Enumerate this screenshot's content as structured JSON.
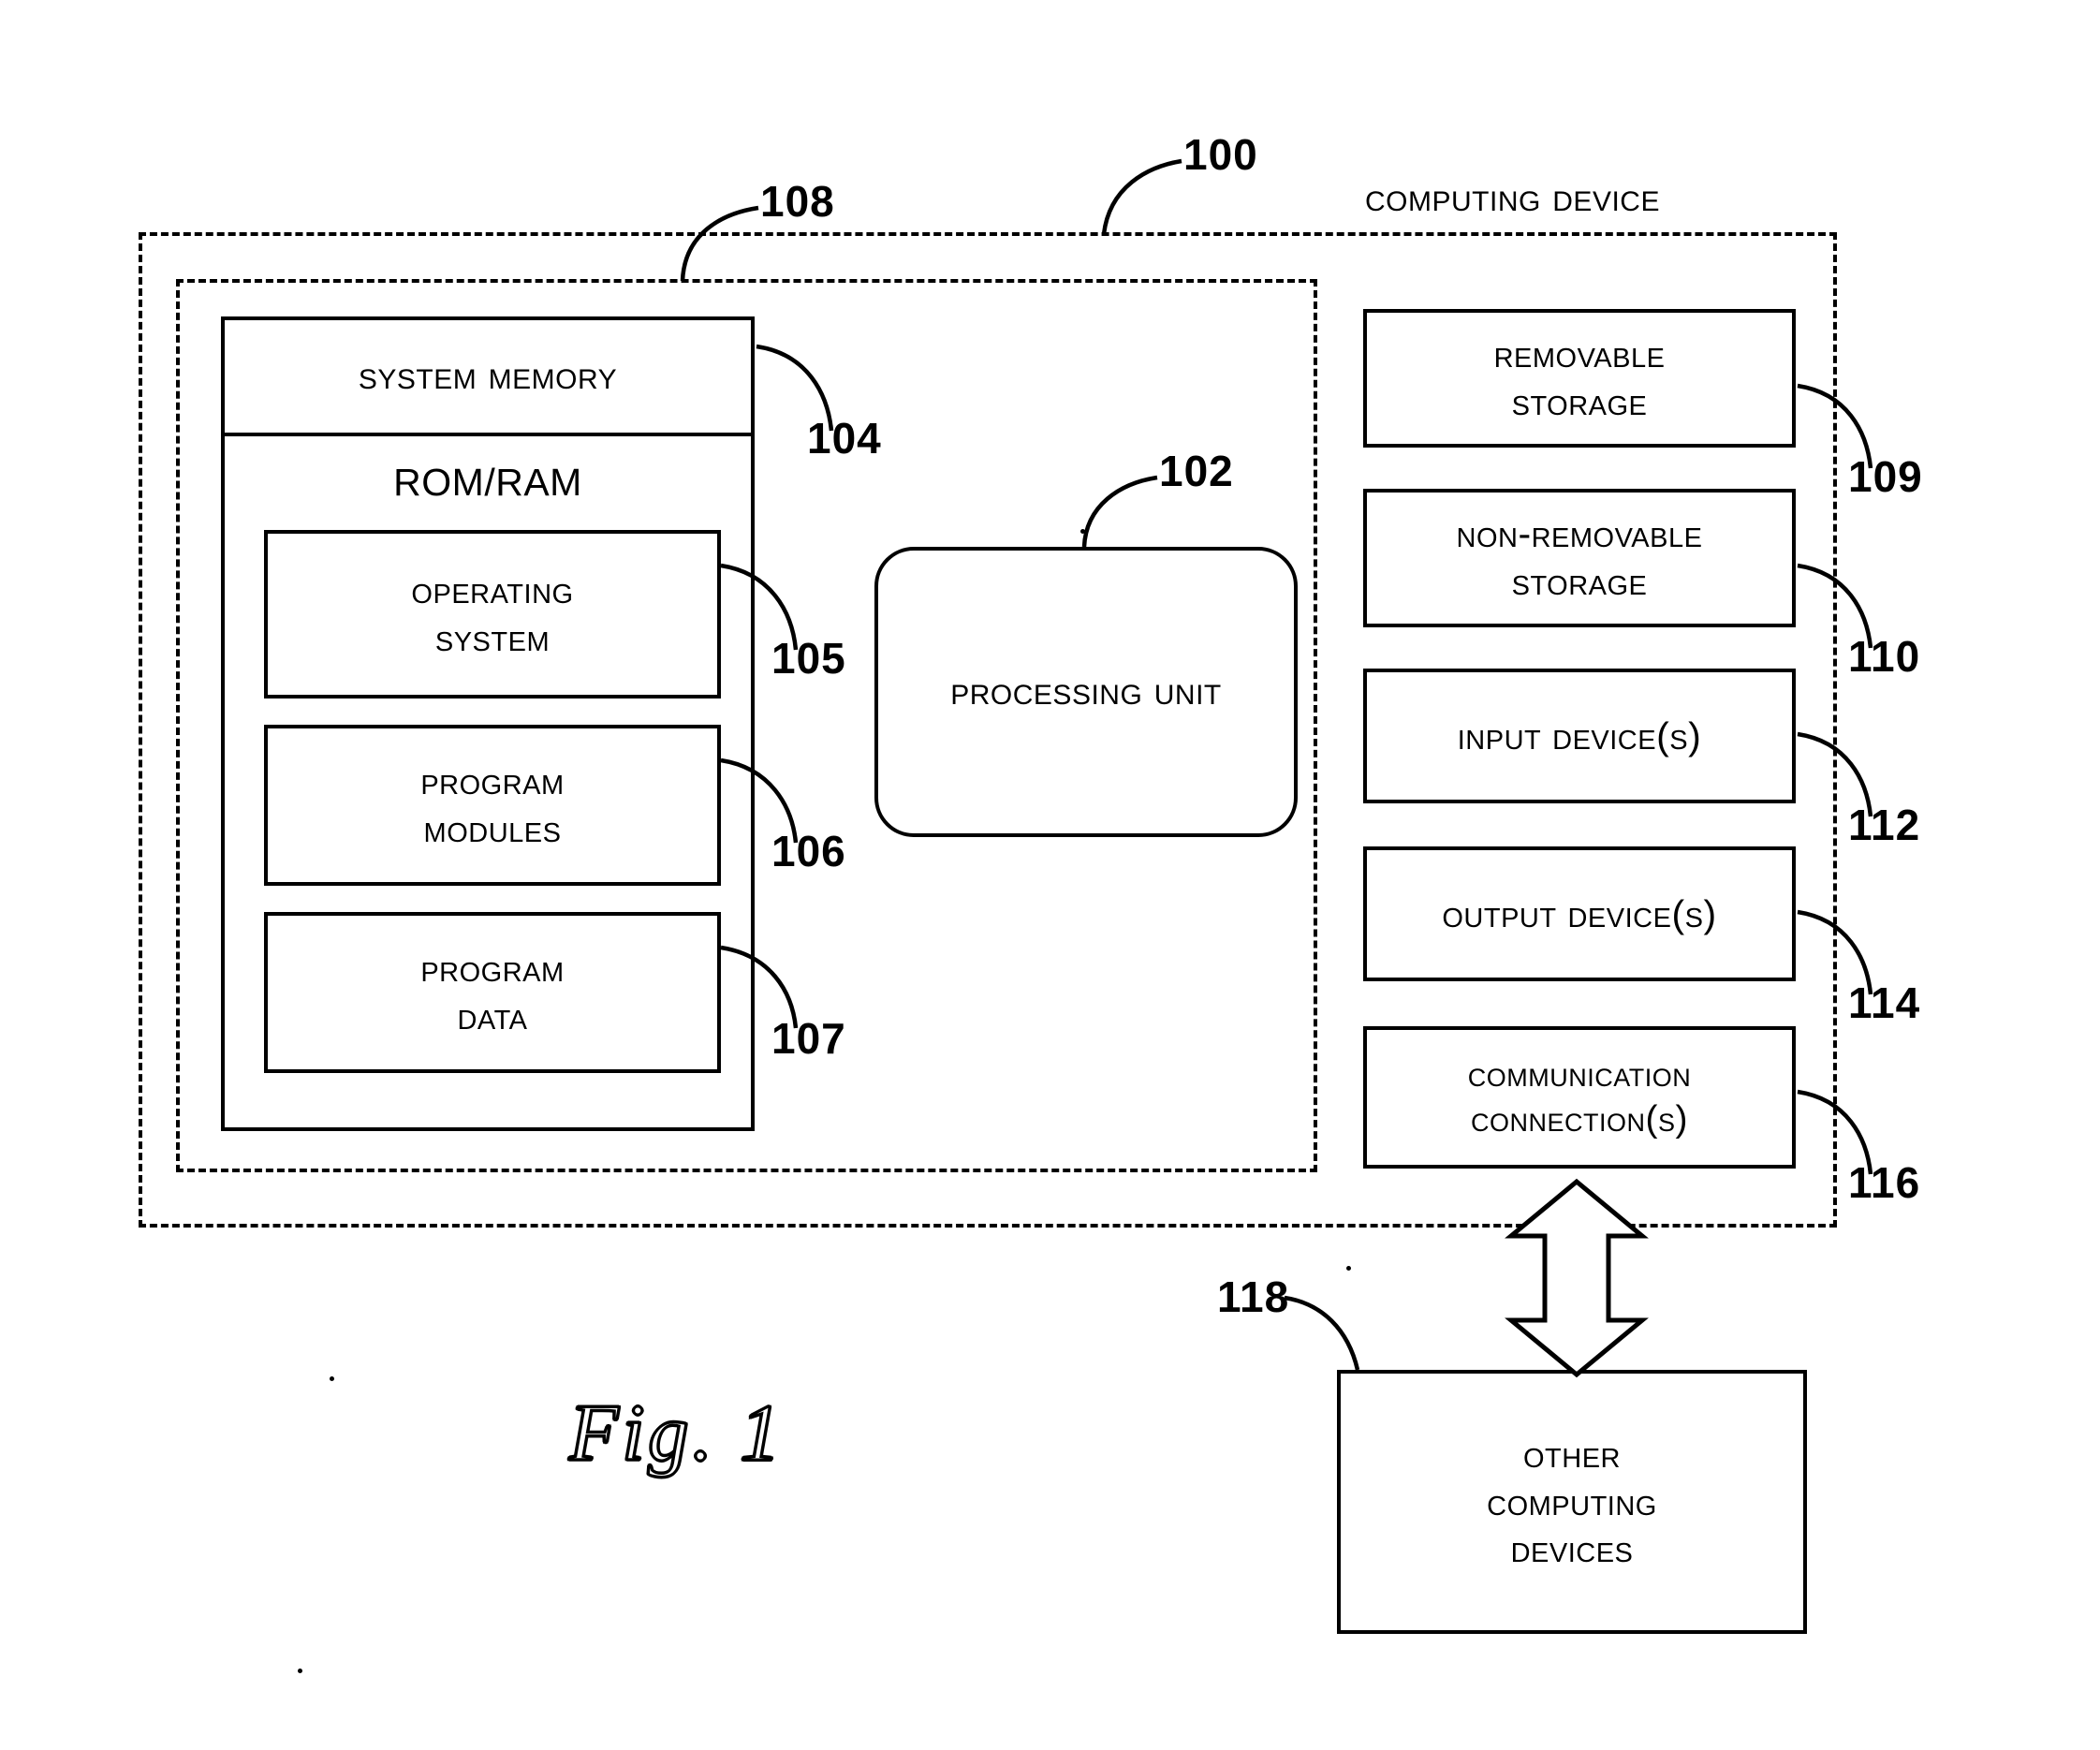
{
  "figure": {
    "caption": "Fig. 1",
    "title": "COMPUTING DEVICE"
  },
  "diagram": {
    "type": "block-diagram",
    "enclosures": [
      {
        "id": "computing-device",
        "label": "COMPUTING DEVICE",
        "ref": "100",
        "style": "dashed"
      },
      {
        "id": "basic-configuration",
        "label": "",
        "ref": "108",
        "style": "dashed"
      }
    ],
    "blocks": [
      {
        "id": "system-memory",
        "label": "SYSTEM MEMORY",
        "ref": "104",
        "shape": "rect"
      },
      {
        "id": "rom-ram",
        "label": "ROM/RAM",
        "ref": "",
        "shape": "rect"
      },
      {
        "id": "operating-system",
        "label": "OPERATING SYSTEM",
        "ref": "105",
        "shape": "rect",
        "lines": [
          "OPERATING",
          "SYSTEM"
        ]
      },
      {
        "id": "program-modules",
        "label": "PROGRAM MODULES",
        "ref": "106",
        "shape": "rect",
        "lines": [
          "PROGRAM",
          "MODULES"
        ]
      },
      {
        "id": "program-data",
        "label": "PROGRAM DATA",
        "ref": "107",
        "shape": "rect",
        "lines": [
          "PROGRAM",
          "DATA"
        ]
      },
      {
        "id": "processing-unit",
        "label": "PROCESSING UNIT",
        "ref": "102",
        "shape": "rounded-rect"
      },
      {
        "id": "removable-storage",
        "label": "REMOVABLE STORAGE",
        "ref": "109",
        "shape": "rect",
        "lines": [
          "REMOVABLE",
          "STORAGE"
        ]
      },
      {
        "id": "non-removable-storage",
        "label": "NON-REMOVABLE STORAGE",
        "ref": "110",
        "shape": "rect",
        "lines": [
          "NON-REMOVABLE",
          "STORAGE"
        ]
      },
      {
        "id": "input-devices",
        "label": "INPUT DEVICE(S)",
        "ref": "112",
        "shape": "rect"
      },
      {
        "id": "output-devices",
        "label": "OUTPUT DEVICE(S)",
        "ref": "114",
        "shape": "rect"
      },
      {
        "id": "communication-connections",
        "label": "COMMUNICATION CONNECTION(S)",
        "ref": "116",
        "shape": "rect",
        "lines": [
          "COMMUNICATION",
          "CONNECTION(S)"
        ]
      },
      {
        "id": "other-computing-devices",
        "label": "OTHER COMPUTING DEVICES",
        "ref": "118",
        "shape": "rect",
        "lines": [
          "OTHER",
          "COMPUTING",
          "DEVICES"
        ]
      }
    ],
    "connectors": [
      {
        "from": "communication-connections",
        "to": "other-computing-devices",
        "style": "hollow-double-arrow",
        "direction": "bidirectional"
      }
    ],
    "colors": {
      "line": "#000000",
      "fill": "#ffffff",
      "text": "#000000"
    }
  },
  "labels": {
    "computing_device": "COMPUTING DEVICE",
    "system_memory": "SYSTEM MEMORY",
    "rom_ram": "ROM/RAM",
    "operating_system_l1": "OPERATING",
    "operating_system_l2": "SYSTEM",
    "program_modules_l1": "PROGRAM",
    "program_modules_l2": "MODULES",
    "program_data_l1": "PROGRAM",
    "program_data_l2": "DATA",
    "processing_unit": "PROCESSING UNIT",
    "removable_storage_l1": "REMOVABLE",
    "removable_storage_l2": "STORAGE",
    "non_removable_storage_l1": "NON-REMOVABLE",
    "non_removable_storage_l2": "STORAGE",
    "input_devices": "INPUT DEVICE(S)",
    "output_devices": "OUTPUT DEVICE(S)",
    "communication_l1": "COMMUNICATION",
    "communication_l2": "CONNECTION(S)",
    "other_computing_l1": "OTHER",
    "other_computing_l2": "COMPUTING",
    "other_computing_l3": "DEVICES",
    "fig_caption": "Fig. 1"
  },
  "refs": {
    "r100": "100",
    "r102": "102",
    "r104": "104",
    "r105": "105",
    "r106": "106",
    "r107": "107",
    "r108": "108",
    "r109": "109",
    "r110": "110",
    "r112": "112",
    "r114": "114",
    "r116": "116",
    "r118": "118"
  }
}
